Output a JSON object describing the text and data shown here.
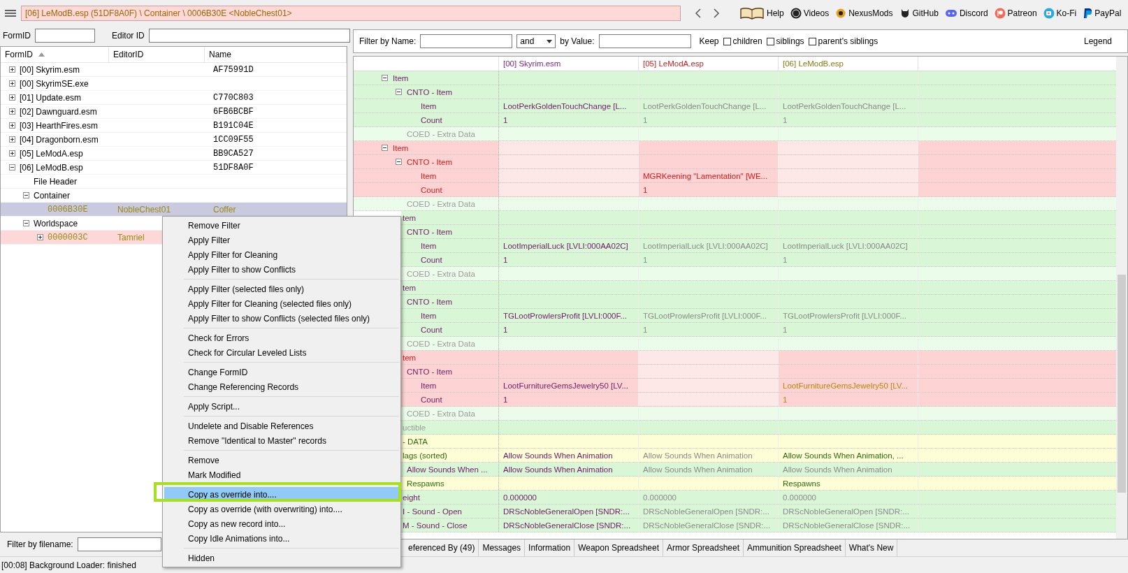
{
  "top_bar": {
    "path": "[06] LeModB.esp (51DF8A0F) \\ Container \\ 0006B30E <NobleChest01>",
    "links": [
      {
        "label": "Help"
      },
      {
        "label": "Videos"
      },
      {
        "label": "NexusMods"
      },
      {
        "label": "GitHub"
      },
      {
        "label": "Discord"
      },
      {
        "label": "Patreon"
      },
      {
        "label": "Ko-Fi"
      },
      {
        "label": "PayPal"
      }
    ]
  },
  "left_filters": [
    {
      "label": "FormID"
    },
    {
      "label": "Editor ID"
    }
  ],
  "tree": {
    "columns": [
      "FormID",
      "EditorID",
      "Name"
    ],
    "rows": [
      {
        "form_id": "[00] Skyrim.esm",
        "name": "AF75991D",
        "expanded": false,
        "selected": false
      },
      {
        "form_id": "[00] SkyrimSE.exe",
        "expanded": false,
        "selected": false
      },
      {
        "form_id": "[01] Update.esm",
        "name": "C770C803",
        "expanded": false,
        "selected": false
      },
      {
        "form_id": "[02] Dawnguard.esm",
        "name": "6FB6BCBF",
        "expanded": false,
        "selected": false
      },
      {
        "form_id": "[03] HearthFires.esm",
        "name": "B191C04E",
        "expanded": false,
        "selected": false
      },
      {
        "form_id": "[04] Dragonborn.esm",
        "name": "1CC09F55",
        "expanded": false,
        "selected": false
      },
      {
        "form_id": "[05] LeModA.esp",
        "name": "BB9CA527",
        "expanded": false,
        "selected": false
      },
      {
        "form_id": "[06] LeModB.esp",
        "name": "51DF8A0F",
        "expanded": true,
        "selected": false,
        "children": [
          {
            "form_id": "File Header",
            "selected": false
          },
          {
            "form_id": "Container",
            "expanded": true,
            "selected": false,
            "children": [
              {
                "kind": "record",
                "form_id": "0006B30E",
                "editor_id": "NobleChest01",
                "name": "Coffer",
                "selected": true
              }
            ]
          },
          {
            "form_id": "Worldspace",
            "expanded": true,
            "selected": false,
            "children": [
              {
                "kind": "conflict",
                "form_id": "0000003C",
                "editor_id": "Tamriel",
                "expanded": false,
                "selected": false
              }
            ]
          }
        ]
      }
    ]
  },
  "file_filter": {
    "label": "Filter by filename:"
  },
  "status_bar": "[00:08] Background Loader: finished",
  "filter_bar": {
    "name_label": "Filter by Name:",
    "operator": "and",
    "value_label": "by Value:",
    "keep_label": "Keep",
    "keep": [
      {
        "label": "children",
        "checked": false
      },
      {
        "label": "siblings",
        "checked": false
      },
      {
        "label": "parent's siblings",
        "checked": false
      }
    ],
    "legend": "Legend"
  },
  "grid": {
    "columns": [
      {
        "label": "[00] Skyrim.esm",
        "color": "#7a1f7a"
      },
      {
        "label": "[05] LeModA.esp",
        "color": "#c81e1e"
      },
      {
        "label": "[06] LeModB.esp",
        "color": "#8a7a10"
      }
    ],
    "rows": [
      {
        "label": "Item",
        "kind": "match",
        "expanded": true,
        "children": [
          {
            "label": "CNTO - Item",
            "kind": "match",
            "expanded": true,
            "children": [
              {
                "label": "Item",
                "kind": "match",
                "cells": [
                  {
                    "text": "LootPerkGoldenTouchChange [L...",
                    "kind": "master"
                  },
                  {
                    "text": "LootPerkGoldenTouchChange [L...",
                    "kind": "same"
                  },
                  {
                    "text": "LootPerkGoldenTouchChange [L...",
                    "kind": "same"
                  }
                ]
              },
              {
                "label": "Count",
                "kind": "match",
                "cells": [
                  {
                    "text": "1",
                    "kind": "master"
                  },
                  {
                    "text": "1",
                    "kind": "same"
                  },
                  {
                    "text": "1",
                    "kind": "same"
                  }
                ]
              }
            ]
          },
          {
            "label": "COED - Extra Data",
            "kind": "extra"
          }
        ]
      },
      {
        "label": "Item",
        "kind": "conflict",
        "expanded": true,
        "cells": [
          {
            "kind": "absent"
          },
          {
            "kind": "hot"
          },
          {
            "kind": "absent"
          }
        ],
        "children": [
          {
            "label": "CNTO - Item",
            "kind": "conflict",
            "expanded": true,
            "cells": [
              {
                "kind": "absent"
              },
              {
                "kind": "hot"
              },
              {
                "kind": "absent"
              }
            ],
            "children": [
              {
                "label": "Item",
                "kind": "conflict",
                "cells": [
                  {
                    "kind": "absent"
                  },
                  {
                    "text": "MGRKeening \"Lamentation\" [WE...",
                    "kind": "conflict"
                  },
                  {
                    "kind": "absent"
                  }
                ]
              },
              {
                "label": "Count",
                "kind": "conflict",
                "cells": [
                  {
                    "kind": "absent"
                  },
                  {
                    "text": "1",
                    "kind": "conflict"
                  },
                  {
                    "kind": "absent"
                  }
                ]
              }
            ]
          },
          {
            "label": "COED - Extra Data",
            "kind": "extra"
          }
        ]
      },
      {
        "label": "tem",
        "kind": "match",
        "expanded": true,
        "children": [
          {
            "label": "CNTO - Item",
            "kind": "match",
            "expanded": true,
            "children": [
              {
                "label": "Item",
                "kind": "match",
                "cells": [
                  {
                    "text": "LootImperialLuck [LVLI:000AA02C]",
                    "kind": "master"
                  },
                  {
                    "text": "LootImperialLuck [LVLI:000AA02C]",
                    "kind": "same"
                  },
                  {
                    "text": "LootImperialLuck [LVLI:000AA02C]",
                    "kind": "same"
                  }
                ]
              },
              {
                "label": "Count",
                "kind": "match",
                "cells": [
                  {
                    "text": "1",
                    "kind": "master"
                  },
                  {
                    "text": "1",
                    "kind": "same"
                  },
                  {
                    "text": "1",
                    "kind": "same"
                  }
                ]
              }
            ]
          },
          {
            "label": "COED - Extra Data",
            "kind": "extra"
          }
        ]
      },
      {
        "label": "tem",
        "kind": "match",
        "expanded": true,
        "children": [
          {
            "label": "CNTO - Item",
            "kind": "match",
            "expanded": true,
            "children": [
              {
                "label": "Item",
                "kind": "match",
                "cells": [
                  {
                    "text": "TGLootProwlersProfit [LVLI:000F...",
                    "kind": "master"
                  },
                  {
                    "text": "TGLootProwlersProfit [LVLI:000F...",
                    "kind": "same"
                  },
                  {
                    "text": "TGLootProwlersProfit [LVLI:000F...",
                    "kind": "same"
                  }
                ]
              },
              {
                "label": "Count",
                "kind": "match",
                "cells": [
                  {
                    "text": "1",
                    "kind": "master"
                  },
                  {
                    "text": "1",
                    "kind": "same"
                  },
                  {
                    "text": "1",
                    "kind": "same"
                  }
                ]
              }
            ]
          },
          {
            "label": "COED - Extra Data",
            "kind": "extra"
          }
        ]
      },
      {
        "label": "tem",
        "kind": "conflict",
        "expanded": true,
        "cells": [
          {
            "kind": "hot"
          },
          {
            "kind": "absent"
          },
          {
            "kind": "hot"
          }
        ],
        "children": [
          {
            "label": "CNTO - Item",
            "kind": "differ",
            "expanded": true,
            "cells": [
              {
                "kind": "hot"
              },
              {
                "kind": "absent"
              },
              {
                "kind": "hot"
              }
            ],
            "children": [
              {
                "label": "Item",
                "kind": "differ",
                "cells": [
                  {
                    "text": "LootFurnitureGemsJewelry50 [LV...",
                    "kind": "base"
                  },
                  {
                    "kind": "absent"
                  },
                  {
                    "text": "LootFurnitureGemsJewelry50 [LV...",
                    "kind": "lose"
                  }
                ]
              },
              {
                "label": "Count",
                "kind": "differ",
                "cells": [
                  {
                    "text": "1",
                    "kind": "base"
                  },
                  {
                    "kind": "absent"
                  },
                  {
                    "text": "1",
                    "kind": "lose"
                  }
                ]
              }
            ]
          },
          {
            "label": "COED - Extra Data",
            "kind": "extra"
          }
        ]
      },
      {
        "label": "uctible",
        "kind": "unused"
      },
      {
        "label": "- DATA",
        "kind": "changed"
      },
      {
        "label": "lags (sorted)",
        "kind": "changed",
        "expanded": true,
        "cells": [
          {
            "text": "Allow Sounds When Animation",
            "kind": "master"
          },
          {
            "text": "Allow Sounds When Animation",
            "kind": "same"
          },
          {
            "text": "Allow Sounds When Animation, ...",
            "kind": "win"
          }
        ],
        "children": [
          {
            "label": "Allow Sounds When ...",
            "kind": "match",
            "cells": [
              {
                "text": "Allow Sounds When Animation",
                "kind": "master"
              },
              {
                "text": "Allow Sounds When Animation",
                "kind": "same"
              },
              {
                "text": "Allow Sounds When Animation",
                "kind": "same"
              }
            ]
          },
          {
            "label": "Respawns",
            "kind": "changed",
            "cells": [
              {},
              {},
              {
                "text": "Respawns",
                "kind": "win"
              }
            ]
          }
        ]
      },
      {
        "label": "eight",
        "kind": "match",
        "cells": [
          {
            "text": "0.000000",
            "kind": "master"
          },
          {
            "text": "0.000000",
            "kind": "same"
          },
          {
            "text": "0.000000",
            "kind": "same"
          }
        ]
      },
      {
        "label": "I - Sound - Open",
        "kind": "match",
        "cells": [
          {
            "text": "DRScNobleGeneralOpen [SNDR:...",
            "kind": "master"
          },
          {
            "text": "DRScNobleGeneralOpen [SNDR:...",
            "kind": "same"
          },
          {
            "text": "DRScNobleGeneralOpen [SNDR:...",
            "kind": "same"
          }
        ]
      },
      {
        "label": "M - Sound - Close",
        "kind": "match",
        "cells": [
          {
            "text": "DRScNobleGeneralClose [SNDR:...",
            "kind": "master"
          },
          {
            "text": "DRScNobleGeneralClose [SNDR:...",
            "kind": "same"
          },
          {
            "text": "DRScNobleGeneralClose [SNDR:...",
            "kind": "same"
          }
        ]
      }
    ]
  },
  "tabs": [
    {
      "label": "eferenced By (49)",
      "selected": false
    },
    {
      "label": "Messages",
      "selected": false
    },
    {
      "label": "Information",
      "selected": false
    },
    {
      "label": "Weapon Spreadsheet",
      "selected": false
    },
    {
      "label": "Armor Spreadsheet",
      "selected": false
    },
    {
      "label": "Ammunition Spreadsheet",
      "selected": false
    },
    {
      "label": "What's New",
      "selected": false
    }
  ],
  "context_menu": {
    "groups": [
      [
        {
          "label": "Remove Filter",
          "selected": false
        },
        {
          "label": "Apply Filter",
          "selected": false
        },
        {
          "label": "Apply Filter for Cleaning",
          "selected": false
        },
        {
          "label": "Apply Filter to show Conflicts",
          "selected": false
        }
      ],
      [
        {
          "label": "Apply Filter (selected files only)",
          "selected": false
        },
        {
          "label": "Apply Filter for Cleaning (selected files only)",
          "selected": false
        },
        {
          "label": "Apply Filter to show Conflicts (selected files only)",
          "selected": false
        }
      ],
      [
        {
          "label": "Check for Errors",
          "selected": false
        },
        {
          "label": "Check for Circular Leveled Lists",
          "selected": false
        }
      ],
      [
        {
          "label": "Change FormID",
          "selected": false
        },
        {
          "label": "Change Referencing Records",
          "selected": false
        }
      ],
      [
        {
          "label": "Apply Script...",
          "selected": false
        }
      ],
      [
        {
          "label": "Undelete and Disable References",
          "selected": false
        },
        {
          "label": "Remove \"Identical to Master\" records",
          "selected": false
        }
      ],
      [
        {
          "label": "Remove",
          "selected": false
        },
        {
          "label": "Mark Modified",
          "selected": false
        }
      ],
      [
        {
          "label": "Copy as override into....",
          "selected": true
        },
        {
          "label": "Copy as override (with overwriting) into....",
          "selected": false
        },
        {
          "label": "Copy as new record into...",
          "selected": false
        },
        {
          "label": "Copy Idle Animations into...",
          "selected": false
        }
      ],
      [
        {
          "label": "Hidden",
          "selected": false
        }
      ]
    ]
  }
}
